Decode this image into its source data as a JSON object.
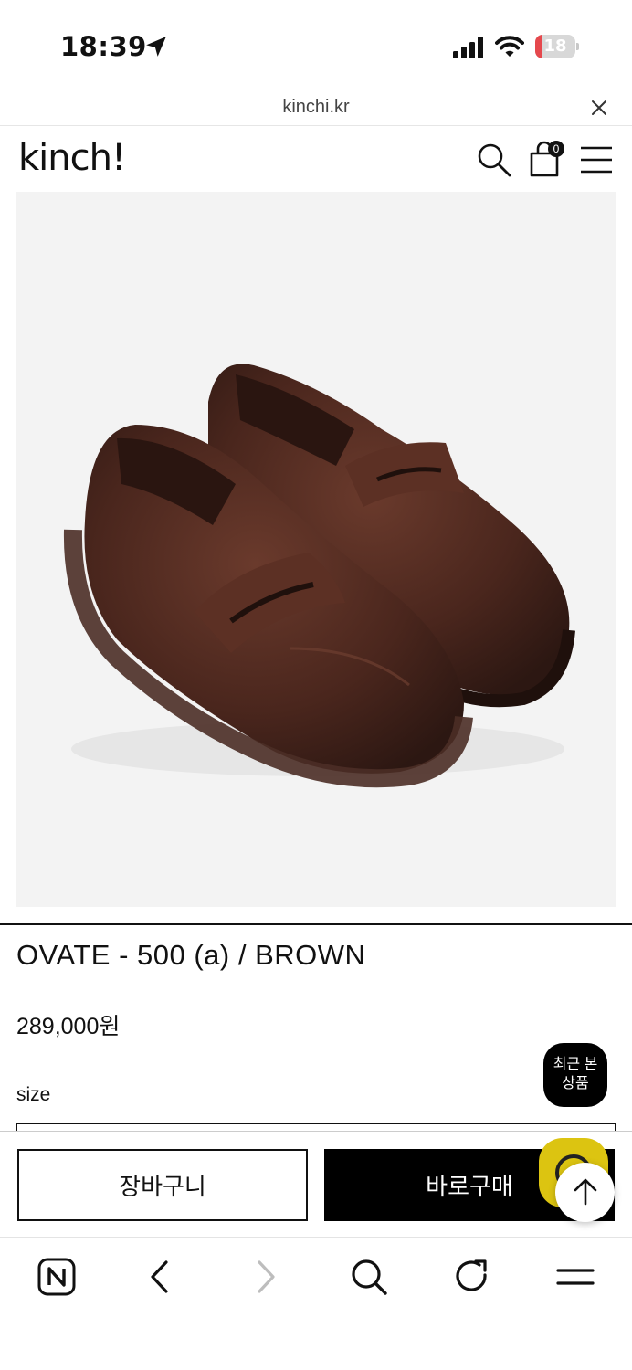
{
  "status_bar": {
    "time": "18:39",
    "battery_level": "18",
    "battery_fraction": 0.18,
    "battery_color": "#e5484d"
  },
  "browser": {
    "url": "kinchi.kr"
  },
  "site": {
    "logo": "kinch!",
    "cart_count": "0"
  },
  "product": {
    "image_alt": "brown leather penny loafers",
    "name": "OVATE - 500 (a) / BROWN",
    "price": "289,000원",
    "size_label": "size"
  },
  "floating": {
    "recent_line1": "최근 본",
    "recent_line2": "상품",
    "chat_color": "#dcc411"
  },
  "actions": {
    "cart_label": "장바구니",
    "buy_label": "바로구매"
  },
  "icons": {
    "status": [
      "location-arrow-icon",
      "signal-icon",
      "wifi-icon",
      "battery-icon"
    ],
    "header": [
      "search-icon",
      "shopping-bag-icon",
      "hamburger-menu-icon"
    ],
    "toolbar": [
      "naver-home-icon",
      "back-icon",
      "forward-icon",
      "search-icon",
      "reload-icon",
      "menu-icon"
    ]
  }
}
